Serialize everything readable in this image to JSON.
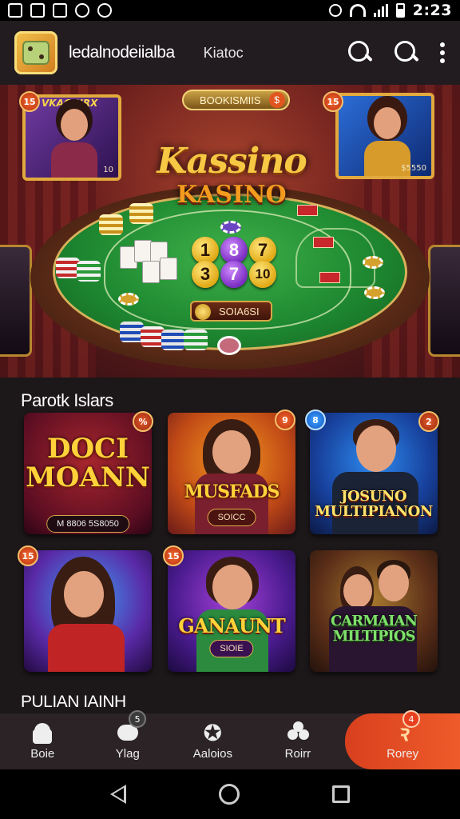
{
  "status_bar": {
    "time": "2:23",
    "left_icons": [
      "notification-icon",
      "qr-icon",
      "image-icon",
      "play-icon",
      "cloud-icon"
    ],
    "right_icons": [
      "alarm-icon",
      "wifi-icon",
      "signal-icon",
      "battery-icon"
    ]
  },
  "app_bar": {
    "title": "ledalnodeiialba",
    "subtitle": "Kiatoc",
    "icons": [
      "app-logo-icon",
      "search-icon",
      "search-icon",
      "more-icon"
    ]
  },
  "hero": {
    "title": "Kassino",
    "title2": "KASINO",
    "top_badge": "BOOKISMIIS",
    "top_badge_num": "$",
    "left_card_caption": "VKAGIURX",
    "left_card_badge": "15",
    "left_card_footer": "10",
    "right_card_badge": "15",
    "right_card_footer": "$5550",
    "balls": [
      "1",
      "8",
      "7",
      "3",
      "7",
      "10"
    ],
    "bottom_pill": "SOIA6SI"
  },
  "section_featured": {
    "title": "Parotk Islars",
    "tiles": [
      {
        "title": "DOCI MOANN",
        "sub": "M 8806 5S8050",
        "badge": "%"
      },
      {
        "title": "MUSFADS",
        "sub": "SOICC",
        "badge": "9"
      },
      {
        "title": "JOSUNO MULTIPIANON",
        "sub": "",
        "badge_left": "8",
        "badge": "2"
      },
      {
        "title": "",
        "sub": "",
        "badge_left": "15"
      },
      {
        "title": "GANAUNT",
        "sub": "SIOIE",
        "badge_left": "15"
      },
      {
        "title": "CARMAIAN MILTIPIOS",
        "sub": ""
      }
    ]
  },
  "section_next": {
    "title": "PULIAN IAINH"
  },
  "bottom_nav": {
    "items": [
      {
        "label": "Boie",
        "icon": "home-icon"
      },
      {
        "label": "Ylag",
        "icon": "chat-icon",
        "badge": "5"
      },
      {
        "label": "Aaloios",
        "icon": "star-icon"
      },
      {
        "label": "Roirr",
        "icon": "clover-icon"
      },
      {
        "label": "Rorey",
        "icon": "flame-icon",
        "badge": "4",
        "active": true
      }
    ]
  },
  "colors": {
    "background": "#1c1719",
    "app_bar": "#221b20",
    "accent": "#e84c23",
    "gold": "#f7c843",
    "felt": "#1f8a31"
  }
}
